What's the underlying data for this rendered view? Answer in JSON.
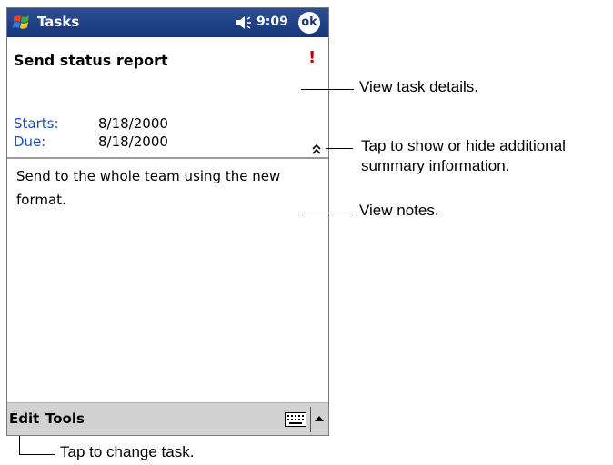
{
  "titlebar": {
    "app_title": "Tasks",
    "time": "9:09",
    "ok_label": "ok",
    "start_icon": "windows-flag-icon",
    "volume_icon": "speaker-icon"
  },
  "task": {
    "title": "Send status report",
    "priority_mark": "!",
    "starts_label": "Starts:",
    "starts_value": "8/18/2000",
    "due_label": "Due:",
    "due_value": "8/18/2000",
    "notes": "Send to the whole team using the new format."
  },
  "menubar": {
    "edit": "Edit",
    "tools": "Tools",
    "keyboard_icon": "keyboard-icon",
    "sip_arrow_icon": "up-arrow-icon"
  },
  "callouts": {
    "details": "View task details.",
    "toggle_line1": "Tap to show or hide additional",
    "toggle_line2": "summary information.",
    "notes": "View notes.",
    "edit": "Tap to change task."
  },
  "colors": {
    "titlebar": "#16357a",
    "label_blue": "#1a54b0",
    "priority_red": "#c00000",
    "menubar": "#d2d2d2"
  }
}
